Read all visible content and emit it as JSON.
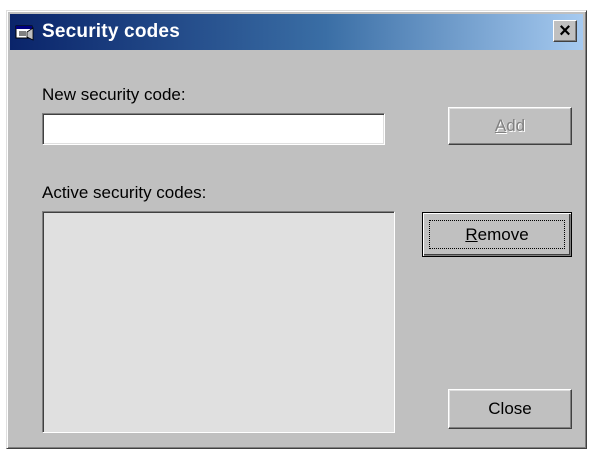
{
  "window": {
    "title": "Security codes",
    "close_glyph": "×",
    "icon": "app-window-icon"
  },
  "form": {
    "new_code_label": "New security code:",
    "new_code_value": "",
    "active_codes_label": "Active security codes:",
    "active_codes": []
  },
  "buttons": {
    "add": {
      "first": "A",
      "rest": "dd",
      "enabled": false
    },
    "remove": {
      "first": "R",
      "rest": "emove",
      "enabled": true,
      "focused": true
    },
    "close": {
      "label": "Close",
      "enabled": true
    }
  },
  "colors": {
    "face": "#c0c0c0",
    "title_start": "#0a246a",
    "title_end": "#a6caf0",
    "disabled_text": "#808080"
  }
}
